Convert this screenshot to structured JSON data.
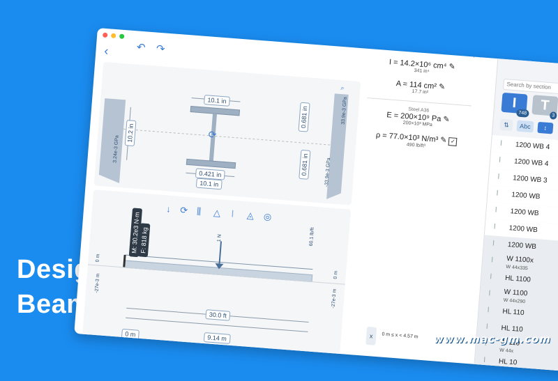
{
  "tagline": {
    "line1": "Design",
    "line2": "Beams"
  },
  "watermark": "www.mac-gm.com",
  "section": {
    "top_width": "10.1 in",
    "flange_thk_top": "0.681 in",
    "flange_thk_bot": "0.681 in",
    "depth": "10.2 in",
    "web_thk": "0.421 in",
    "bottom_width": "10.1 in",
    "left_label": "3.24e-3 GPa",
    "right_top_label": "33.9e-3 GPa",
    "right_bot_label": "-33.9e-3 GPa"
  },
  "props": {
    "inertia": "I = 14.2×10⁶ cm⁴",
    "inertia_sub": "341 in⁴",
    "area": "A = 114 cm²",
    "area_sub": "17.7 in²",
    "material": "Steel A36",
    "modulus": "E = 200×10⁹ Pa",
    "modulus_sub": "200×10³ MPa",
    "density": "ρ = 77.0×10³ N/m³",
    "density_sub": "490 lb/ft³"
  },
  "beam": {
    "moment_label": "M: 30.2e3 N·m",
    "force_label": "F: 818 kg",
    "point_load": "1 N",
    "dist_load": "60.1 lb/ft",
    "left_zero": "0 m",
    "right_zero": "0 m",
    "left_stress": "-27e-3 m",
    "right_stress": "-27e-3 m",
    "span_ft": "30.0 ft",
    "span_m": "9.14 m",
    "origin": "0 m",
    "range": "0 m ≤ x < 4.57 m",
    "close": "x"
  },
  "browser": {
    "search_placeholder": "Search by section",
    "count_i": "748",
    "count_t": "3",
    "abc": "Abc",
    "items": [
      {
        "name": "1200 WB 4",
        "sub": ""
      },
      {
        "name": "1200 WB 4",
        "sub": ""
      },
      {
        "name": "1200 WB 3",
        "sub": ""
      },
      {
        "name": "1200 WB",
        "sub": ""
      },
      {
        "name": "1200 WB",
        "sub": ""
      },
      {
        "name": "1200 WB",
        "sub": ""
      },
      {
        "name": "1200 WB",
        "sub": ""
      },
      {
        "name": "W 1100x",
        "sub": "W 44x335"
      },
      {
        "name": "HL 1100",
        "sub": ""
      },
      {
        "name": "W 1100",
        "sub": "W 44x290"
      },
      {
        "name": "HL 110",
        "sub": ""
      },
      {
        "name": "HL 110",
        "sub": ""
      },
      {
        "name": "W 110",
        "sub": "W 44x"
      },
      {
        "name": "HL 10",
        "sub": ""
      }
    ]
  },
  "colors": {
    "accent": "#3a7bd5",
    "background": "#1a8cf0",
    "steel": "#9fb0c2"
  }
}
